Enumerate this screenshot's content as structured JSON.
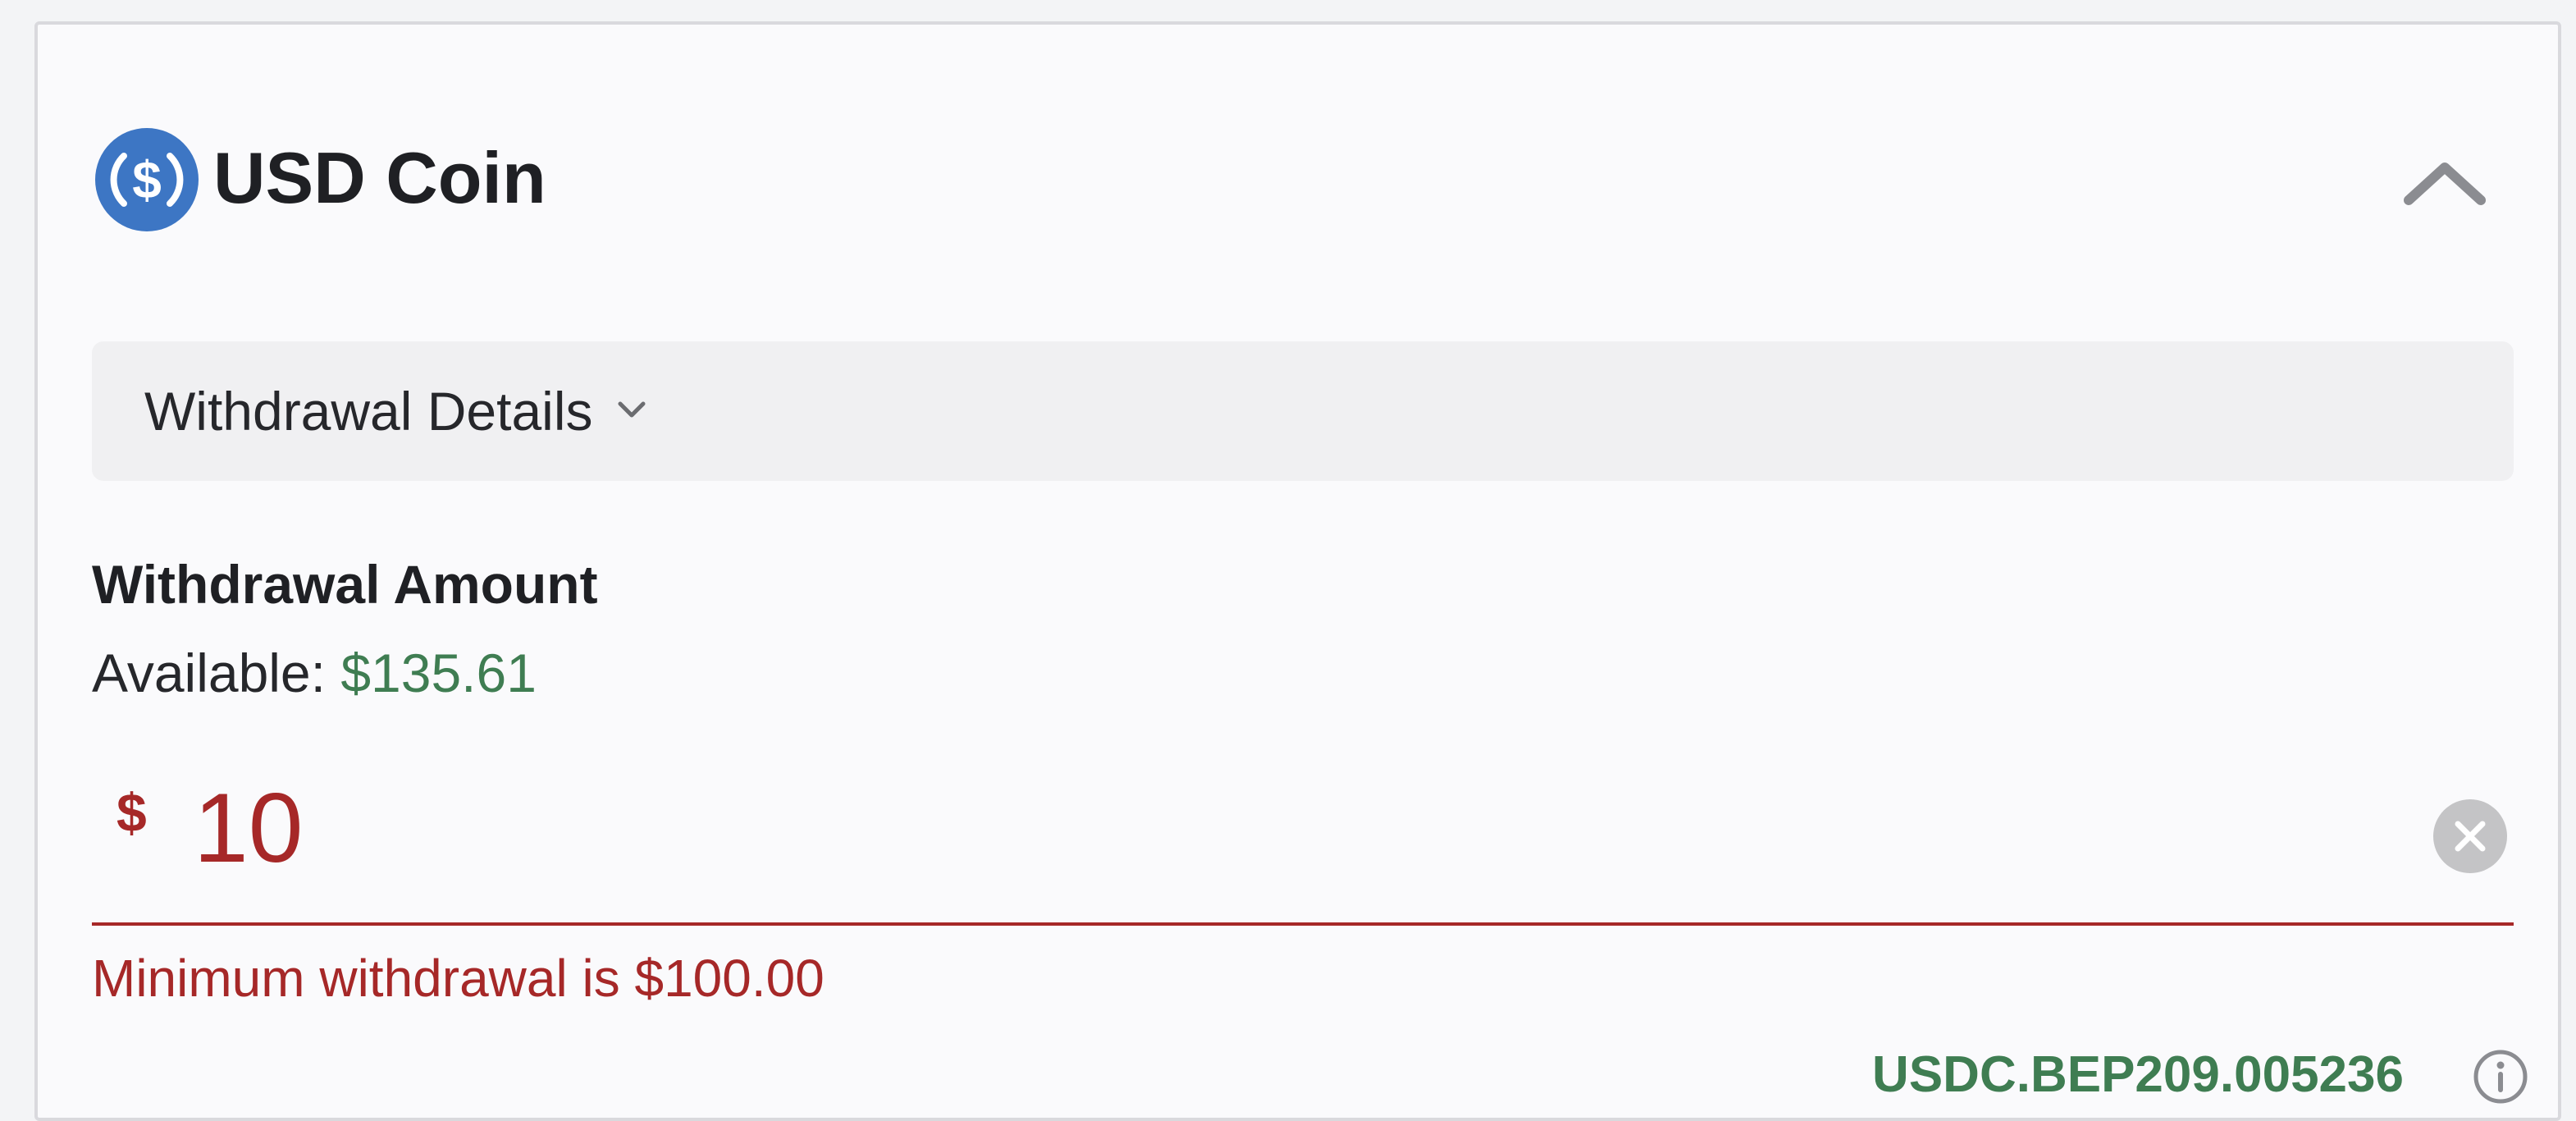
{
  "header": {
    "title": "USD Coin",
    "coin_icon": "usdc-dollar-circle-icon",
    "collapse_icon": "chevron-up-icon"
  },
  "details": {
    "label": "Withdrawal Details",
    "chevron_icon": "chevron-down-icon"
  },
  "amount": {
    "heading": "Withdrawal Amount",
    "available_label": "Available:",
    "available_value": "$135.61",
    "currency_symbol": "$",
    "value": "10",
    "clear_icon": "clear-x-circle-icon",
    "error": "Minimum withdrawal is $100.00"
  },
  "network": {
    "code": "USDC.BEP209.005236",
    "info_icon": "info-circle-icon"
  },
  "colors": {
    "brand_blue": "#3d76c4",
    "success_green": "#3f7d52",
    "error_red": "#a62828",
    "card_background": "#fafafc",
    "details_background": "#f0f0f2"
  }
}
